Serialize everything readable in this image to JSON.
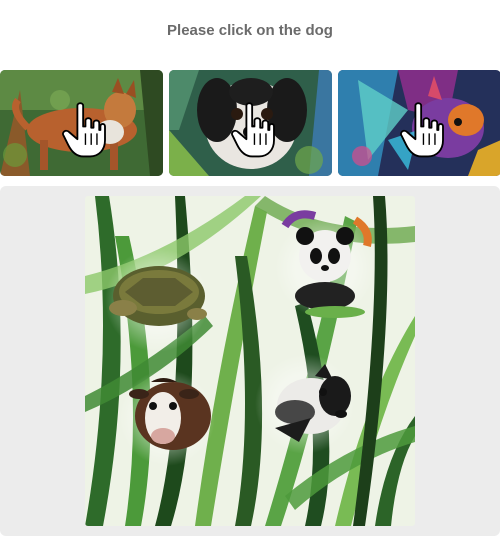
{
  "challenge": {
    "prompt": "Please click on the dog"
  },
  "thumbnails": [
    {
      "subject": "dog",
      "cursor_icon": "pointer-hand-icon"
    },
    {
      "subject": "dog",
      "cursor_icon": "pointer-hand-icon"
    },
    {
      "subject": "dog",
      "cursor_icon": "pointer-hand-icon"
    }
  ],
  "scene": {
    "background": "jungle-grass-watercolor",
    "animals": [
      "turtle",
      "panda",
      "cow",
      "dog"
    ]
  },
  "colors": {
    "prompt_text": "#6b6b6b",
    "panel_background": "#ececec",
    "page_background": "#ffffff"
  }
}
